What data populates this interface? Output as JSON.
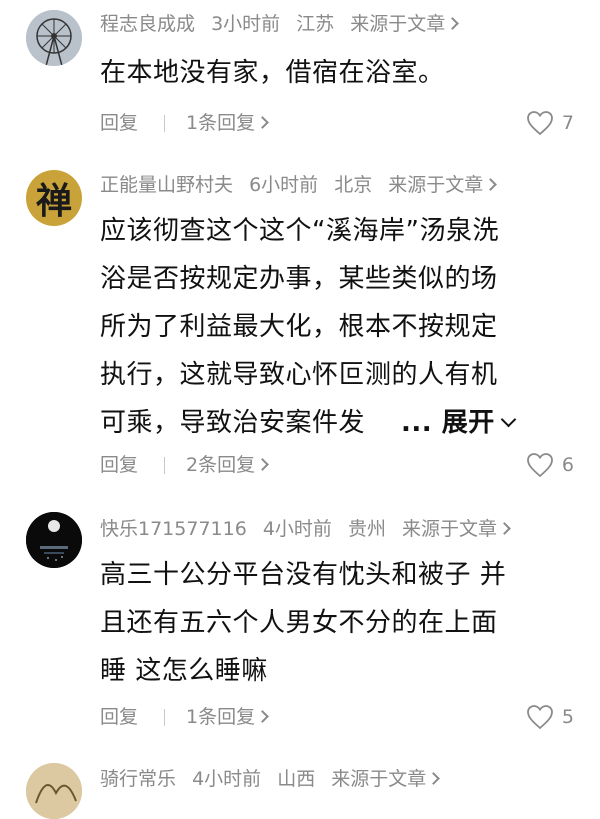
{
  "comments": [
    {
      "username": "程志良成成",
      "time": "3小时前",
      "location": "江苏",
      "source": "来源于文章",
      "lines": [
        "在本地没有家，借宿在浴室。"
      ],
      "reply_label": "回复",
      "reply_count": "1条回复",
      "likes": "7"
    },
    {
      "username": "正能量山野村夫",
      "time": "6小时前",
      "location": "北京",
      "source": "来源于文章",
      "lines": [
        "应该彻查这个这个“溪海岸”汤泉洗",
        "浴是否按规定办事，某些类似的场",
        "所为了利益最大化，根本不按规定",
        "执行，这就导致心怀叵测的人有机",
        "可乘，导致治安案件发"
      ],
      "expand_label": "... 展开",
      "avatar_char": "禅",
      "reply_label": "回复",
      "reply_count": "2条回复",
      "likes": "6"
    },
    {
      "username": "快乐171577116",
      "time": "4小时前",
      "location": "贵州",
      "source": "来源于文章",
      "lines": [
        "高三十公分平台没有忱头和被子 并",
        "且还有五六个人男女不分的在上面",
        "睡 这怎么睡嘛"
      ],
      "reply_label": "回复",
      "reply_count": "1条回复",
      "likes": "5"
    },
    {
      "username": "骑行常乐",
      "time": "4小时前",
      "location": "山西",
      "source": "来源于文章"
    }
  ],
  "colors": {
    "meta": "#8a8a8a",
    "text": "#111111",
    "avatar2_bg": "#c9a23a"
  }
}
